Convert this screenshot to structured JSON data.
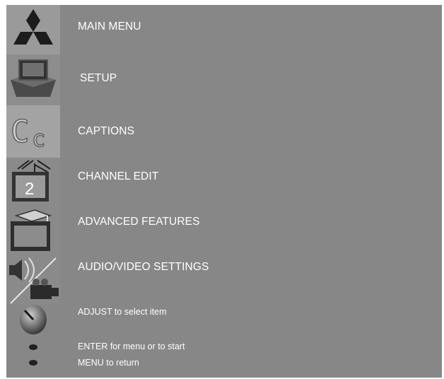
{
  "menu": {
    "title": "MAIN MENU",
    "items": [
      {
        "label": "SETUP",
        "icon": "tv-setup-icon"
      },
      {
        "label": "CAPTIONS",
        "icon": "closed-captions-icon"
      },
      {
        "label": "CHANNEL EDIT",
        "icon": "channel-edit-icon"
      },
      {
        "label": "ADVANCED FEATURES",
        "icon": "advanced-features-icon"
      },
      {
        "label": "AUDIO/VIDEO SETTINGS",
        "icon": "audio-video-icon"
      }
    ]
  },
  "hints": {
    "adjust": "ADJUST to select item",
    "enter": "ENTER for menu or to start",
    "menu": "MENU to return"
  },
  "colors": {
    "background": "#878787",
    "text": "#ffffff",
    "brand_logo": "#1a1a1a"
  }
}
